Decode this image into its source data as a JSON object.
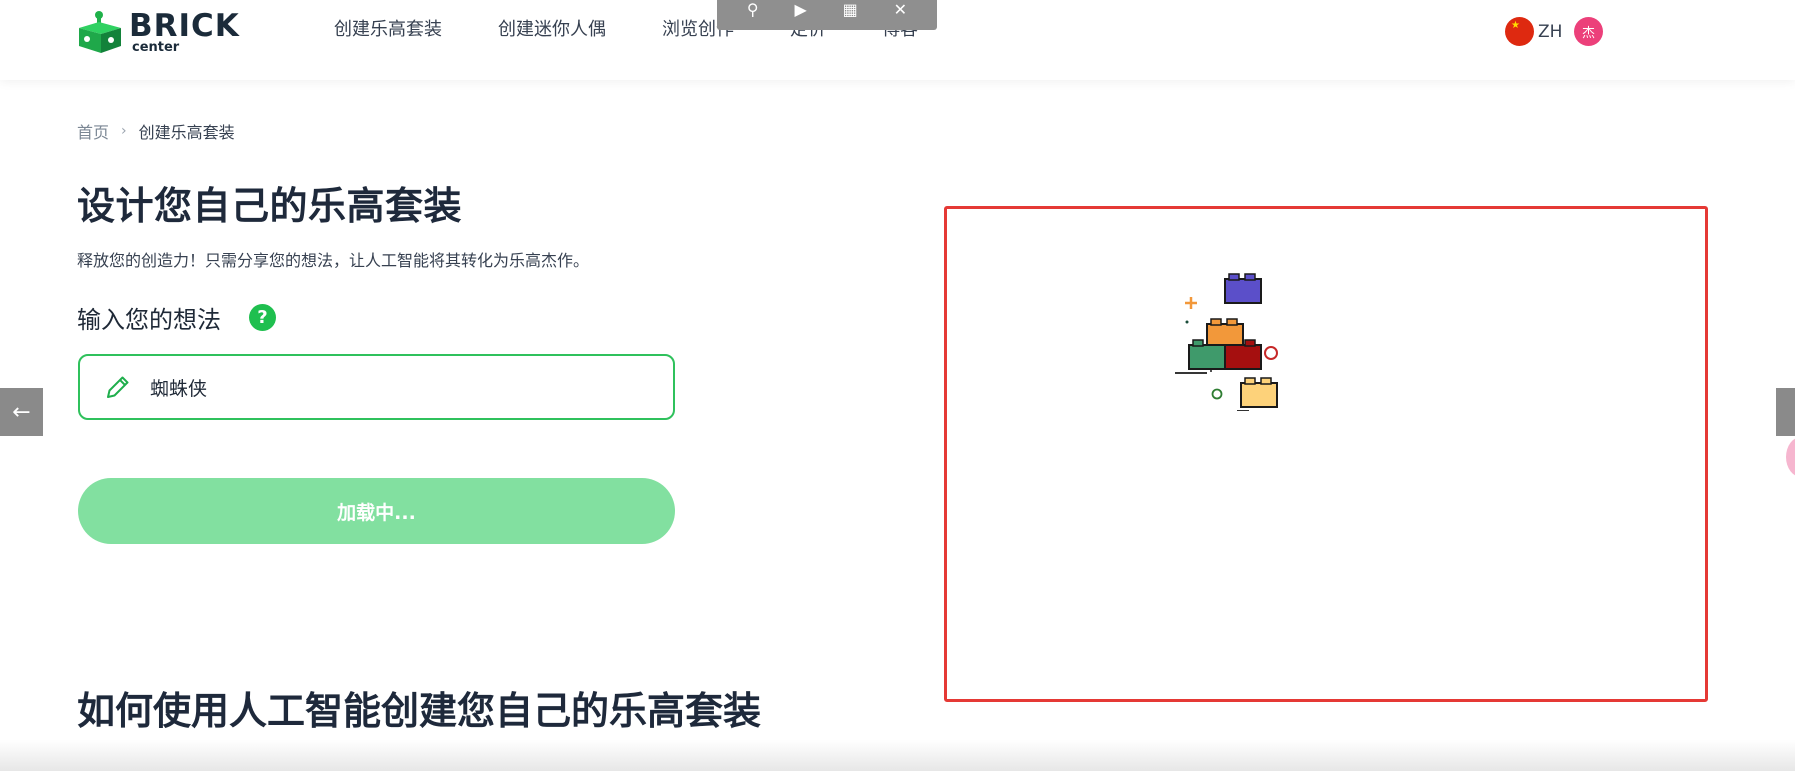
{
  "header": {
    "logo": {
      "word": "BRICK",
      "sub": "center"
    },
    "nav": [
      {
        "label": "创建乐高套装"
      },
      {
        "label": "创建迷你人偶"
      },
      {
        "label": "浏览创作"
      },
      {
        "label": "定价"
      },
      {
        "label": "博客"
      }
    ],
    "language": {
      "label": "ZH",
      "flag_icon": "china-flag-icon"
    },
    "avatar": {
      "initial": "杰",
      "color": "#ec407a"
    }
  },
  "breadcrumb": {
    "home": "首页",
    "separator": "›",
    "current": "创建乐高套装"
  },
  "main": {
    "title": "设计您自己的乐高套装",
    "subtitle": "释放您的创造力！只需分享您的想法，让人工智能将其转化为乐高杰作。",
    "input_label": "输入您的想法",
    "help_icon": "?",
    "input_value": "蜘蛛侠",
    "button_label": "加载中...",
    "section_title": "如何使用人工智能创建您自己的乐高套装"
  },
  "preview": {
    "loader_icon": "brick-stack-loading-icon",
    "border_color": "#e53935"
  },
  "side_nav": {
    "left_icon": "←"
  },
  "colors": {
    "accent": "#2fc15c",
    "button_disabled": "#82e0a0",
    "title": "#1e293b"
  }
}
